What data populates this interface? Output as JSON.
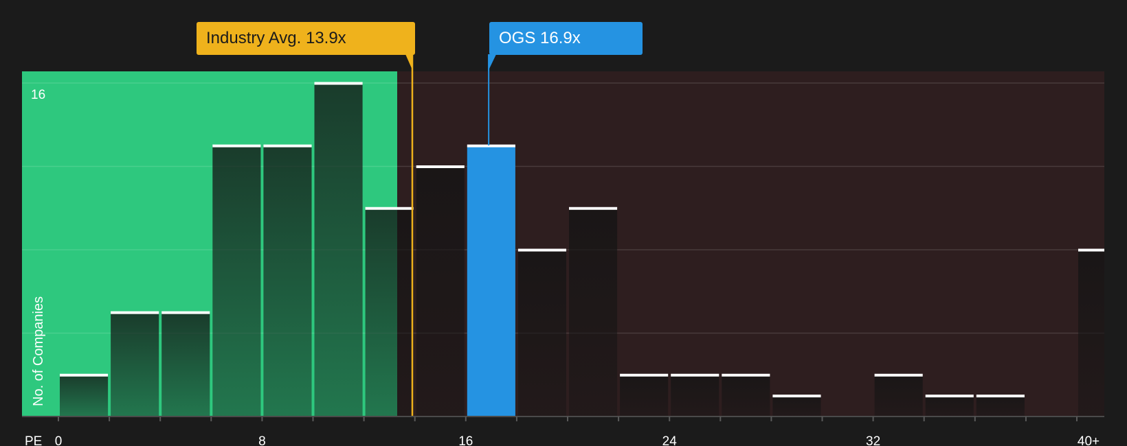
{
  "chart_data": {
    "type": "bar",
    "xlabel": "PE",
    "ylabel": "No. of Companies",
    "ylim": [
      0,
      16
    ],
    "y_tick_labels": [
      "16"
    ],
    "x_tick_labels": [
      "0",
      "8",
      "16",
      "24",
      "32",
      "40+"
    ],
    "x_tick_values": [
      0,
      8,
      16,
      24,
      32,
      40
    ],
    "bin_width": 2,
    "bins": [
      {
        "start": 0,
        "value": 2
      },
      {
        "start": 2,
        "value": 5
      },
      {
        "start": 4,
        "value": 5
      },
      {
        "start": 6,
        "value": 13
      },
      {
        "start": 8,
        "value": 13
      },
      {
        "start": 10,
        "value": 16
      },
      {
        "start": 12,
        "value": 10
      },
      {
        "start": 14,
        "value": 12
      },
      {
        "start": 16,
        "value": 13,
        "highlight": true
      },
      {
        "start": 18,
        "value": 8
      },
      {
        "start": 20,
        "value": 10
      },
      {
        "start": 22,
        "value": 2
      },
      {
        "start": 24,
        "value": 2
      },
      {
        "start": 26,
        "value": 2
      },
      {
        "start": 28,
        "value": 1
      },
      {
        "start": 30,
        "value": 0
      },
      {
        "start": 32,
        "value": 2
      },
      {
        "start": 34,
        "value": 1
      },
      {
        "start": 36,
        "value": 1
      },
      {
        "start": 38,
        "value": 0
      },
      {
        "start": 40,
        "value": 8
      }
    ],
    "industry_avg": {
      "label": "Industry Avg. 13.9x",
      "value": 13.9
    },
    "company": {
      "label": "OGS 16.9x",
      "value": 16.9
    },
    "colors": {
      "background": "#1b1b1b",
      "good_zone": "#2ec87e",
      "bad_zone": "#2e1e1f",
      "highlight_bar": "#2593e2",
      "industry_line": "#efb21c",
      "bar_cap": "#ffffff"
    }
  }
}
